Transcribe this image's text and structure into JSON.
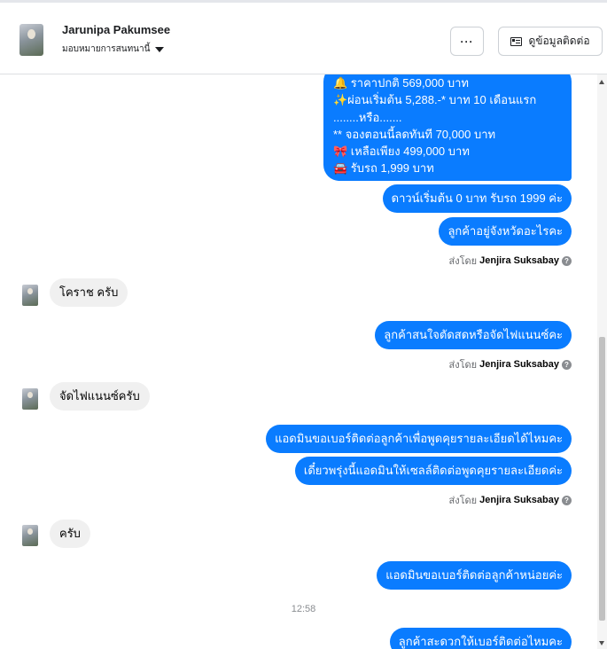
{
  "header": {
    "name": "Jarunipa Pakumsee",
    "assign_label": "มอบหมายการสนทนานี้",
    "more_label": "···",
    "contact_label": "ดูข้อมูลติดต่อ"
  },
  "promo_lines": [
    "🔔 ราคาปกติ 569,000 บาท",
    "✨ผ่อนเริ่มต้น 5,288.-* บาท 10 เดือนแรก",
    "........หรือ.......",
    "** จองตอนนี้ลดทันที 70,000 บาท",
    "🎀  เหลือเพียง 499,000 บาท",
    "🚘 รับรถ 1,999 บาท"
  ],
  "messages": {
    "out_1": "ดาวน์เริ่มต้น 0 บาท รับรถ 1999 ค่ะ",
    "out_2": "ลูกค้าอยู่จังหวัดอะไรคะ",
    "in_1": "โคราช ครับ",
    "out_3": "ลูกค้าสนใจตัดสดหรือจัดไฟแนนซ์คะ",
    "in_2": "จัดไฟแนนซ์ครับ",
    "out_4": "แอดมินขอเบอร์ติดต่อลูกค้าเพื่อพูดคุยรายละเอียดได้ไหมคะ",
    "out_5": "เดี๋ยวพรุ่งนี้แอดมินให้เซลล์ติดต่อพูดคุยรายละเอียดค่ะ",
    "in_3": "ครับ",
    "out_6": "แอดมินขอเบอร์ติดต่อลูกค้าหน่อยค่ะ",
    "out_7": "ลูกค้าสะดวกให้เบอร์ติดต่อไหมคะ"
  },
  "sent_by": {
    "prefix": "ส่งโดย",
    "agent": "Jenjira Suksabay",
    "info": "?"
  },
  "timestamp": "12:58"
}
